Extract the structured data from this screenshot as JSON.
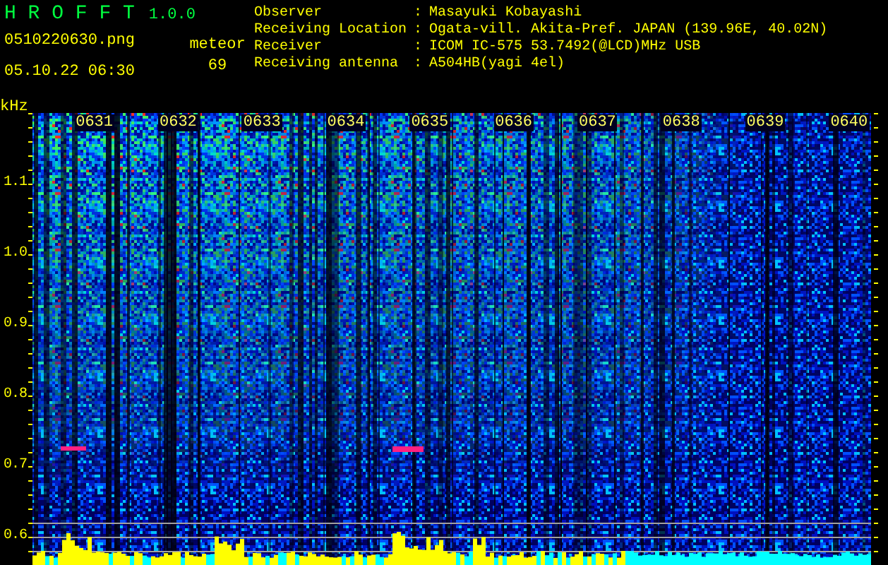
{
  "app": {
    "title": "H R O F F T",
    "version": "1.0.0"
  },
  "file": "0510220630.png",
  "datetime": "05.10.22 06:30",
  "meteor": {
    "label": "meteor",
    "count": "69"
  },
  "station": [
    {
      "label": "Observer",
      "separator": ":",
      "value": "Masayuki Kobayashi"
    },
    {
      "label": "Receiving Location",
      "separator": ":",
      "value": "Ogata-vill. Akita-Pref. JAPAN (139.96E, 40.02N)"
    },
    {
      "label": "Receiver",
      "separator": ":",
      "value": "ICOM IC-575 53.7492(@LCD)MHz USB"
    },
    {
      "label": "Receiving antenna",
      "separator": ":",
      "value": "A504HB(yagi 4el)"
    }
  ],
  "spectrogram": {
    "unit": "kHz",
    "time_labels": [
      "0631",
      "0632",
      "0633",
      "0634",
      "0635",
      "0636",
      "0637",
      "0638",
      "0639",
      "0640"
    ],
    "freq_labels": [
      "1.1",
      "1.0",
      "0.9",
      "0.8",
      "0.7",
      "0.6"
    ]
  }
}
